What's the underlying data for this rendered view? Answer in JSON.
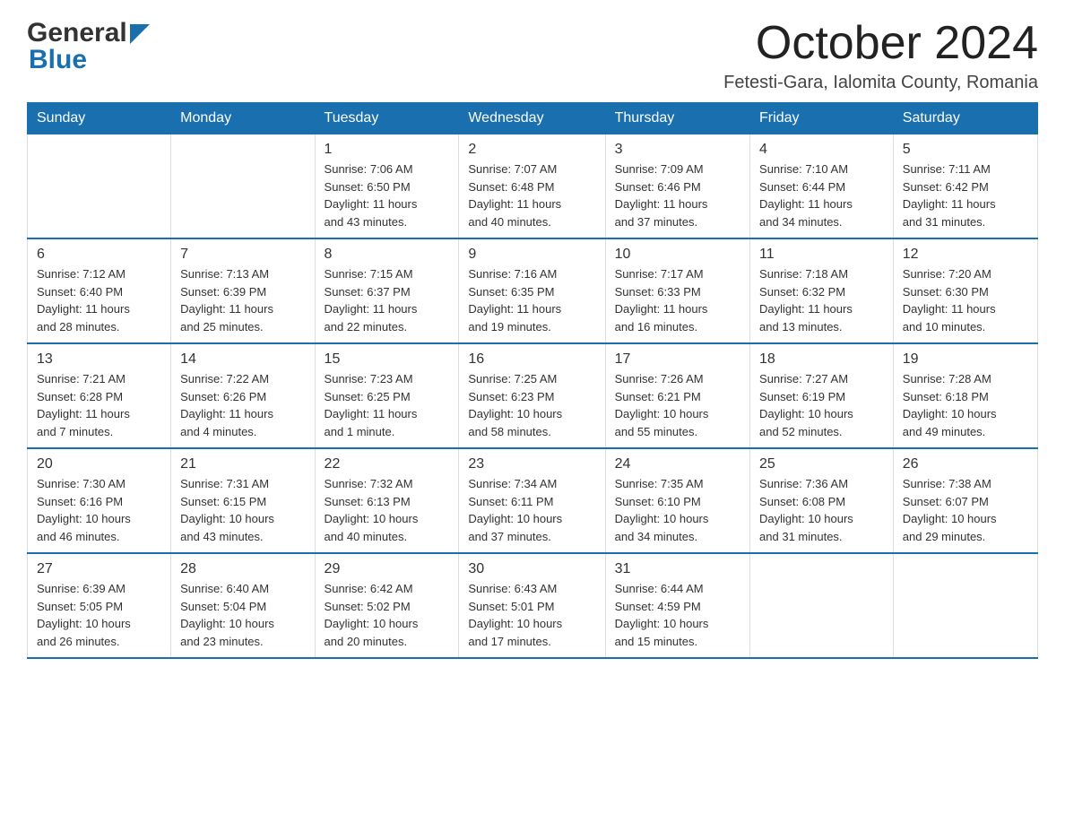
{
  "logo": {
    "general": "General",
    "blue": "Blue"
  },
  "header": {
    "title": "October 2024",
    "subtitle": "Fetesti-Gara, Ialomita County, Romania"
  },
  "days_of_week": [
    "Sunday",
    "Monday",
    "Tuesday",
    "Wednesday",
    "Thursday",
    "Friday",
    "Saturday"
  ],
  "weeks": [
    [
      {
        "day": "",
        "info": ""
      },
      {
        "day": "",
        "info": ""
      },
      {
        "day": "1",
        "info": "Sunrise: 7:06 AM\nSunset: 6:50 PM\nDaylight: 11 hours\nand 43 minutes."
      },
      {
        "day": "2",
        "info": "Sunrise: 7:07 AM\nSunset: 6:48 PM\nDaylight: 11 hours\nand 40 minutes."
      },
      {
        "day": "3",
        "info": "Sunrise: 7:09 AM\nSunset: 6:46 PM\nDaylight: 11 hours\nand 37 minutes."
      },
      {
        "day": "4",
        "info": "Sunrise: 7:10 AM\nSunset: 6:44 PM\nDaylight: 11 hours\nand 34 minutes."
      },
      {
        "day": "5",
        "info": "Sunrise: 7:11 AM\nSunset: 6:42 PM\nDaylight: 11 hours\nand 31 minutes."
      }
    ],
    [
      {
        "day": "6",
        "info": "Sunrise: 7:12 AM\nSunset: 6:40 PM\nDaylight: 11 hours\nand 28 minutes."
      },
      {
        "day": "7",
        "info": "Sunrise: 7:13 AM\nSunset: 6:39 PM\nDaylight: 11 hours\nand 25 minutes."
      },
      {
        "day": "8",
        "info": "Sunrise: 7:15 AM\nSunset: 6:37 PM\nDaylight: 11 hours\nand 22 minutes."
      },
      {
        "day": "9",
        "info": "Sunrise: 7:16 AM\nSunset: 6:35 PM\nDaylight: 11 hours\nand 19 minutes."
      },
      {
        "day": "10",
        "info": "Sunrise: 7:17 AM\nSunset: 6:33 PM\nDaylight: 11 hours\nand 16 minutes."
      },
      {
        "day": "11",
        "info": "Sunrise: 7:18 AM\nSunset: 6:32 PM\nDaylight: 11 hours\nand 13 minutes."
      },
      {
        "day": "12",
        "info": "Sunrise: 7:20 AM\nSunset: 6:30 PM\nDaylight: 11 hours\nand 10 minutes."
      }
    ],
    [
      {
        "day": "13",
        "info": "Sunrise: 7:21 AM\nSunset: 6:28 PM\nDaylight: 11 hours\nand 7 minutes."
      },
      {
        "day": "14",
        "info": "Sunrise: 7:22 AM\nSunset: 6:26 PM\nDaylight: 11 hours\nand 4 minutes."
      },
      {
        "day": "15",
        "info": "Sunrise: 7:23 AM\nSunset: 6:25 PM\nDaylight: 11 hours\nand 1 minute."
      },
      {
        "day": "16",
        "info": "Sunrise: 7:25 AM\nSunset: 6:23 PM\nDaylight: 10 hours\nand 58 minutes."
      },
      {
        "day": "17",
        "info": "Sunrise: 7:26 AM\nSunset: 6:21 PM\nDaylight: 10 hours\nand 55 minutes."
      },
      {
        "day": "18",
        "info": "Sunrise: 7:27 AM\nSunset: 6:19 PM\nDaylight: 10 hours\nand 52 minutes."
      },
      {
        "day": "19",
        "info": "Sunrise: 7:28 AM\nSunset: 6:18 PM\nDaylight: 10 hours\nand 49 minutes."
      }
    ],
    [
      {
        "day": "20",
        "info": "Sunrise: 7:30 AM\nSunset: 6:16 PM\nDaylight: 10 hours\nand 46 minutes."
      },
      {
        "day": "21",
        "info": "Sunrise: 7:31 AM\nSunset: 6:15 PM\nDaylight: 10 hours\nand 43 minutes."
      },
      {
        "day": "22",
        "info": "Sunrise: 7:32 AM\nSunset: 6:13 PM\nDaylight: 10 hours\nand 40 minutes."
      },
      {
        "day": "23",
        "info": "Sunrise: 7:34 AM\nSunset: 6:11 PM\nDaylight: 10 hours\nand 37 minutes."
      },
      {
        "day": "24",
        "info": "Sunrise: 7:35 AM\nSunset: 6:10 PM\nDaylight: 10 hours\nand 34 minutes."
      },
      {
        "day": "25",
        "info": "Sunrise: 7:36 AM\nSunset: 6:08 PM\nDaylight: 10 hours\nand 31 minutes."
      },
      {
        "day": "26",
        "info": "Sunrise: 7:38 AM\nSunset: 6:07 PM\nDaylight: 10 hours\nand 29 minutes."
      }
    ],
    [
      {
        "day": "27",
        "info": "Sunrise: 6:39 AM\nSunset: 5:05 PM\nDaylight: 10 hours\nand 26 minutes."
      },
      {
        "day": "28",
        "info": "Sunrise: 6:40 AM\nSunset: 5:04 PM\nDaylight: 10 hours\nand 23 minutes."
      },
      {
        "day": "29",
        "info": "Sunrise: 6:42 AM\nSunset: 5:02 PM\nDaylight: 10 hours\nand 20 minutes."
      },
      {
        "day": "30",
        "info": "Sunrise: 6:43 AM\nSunset: 5:01 PM\nDaylight: 10 hours\nand 17 minutes."
      },
      {
        "day": "31",
        "info": "Sunrise: 6:44 AM\nSunset: 4:59 PM\nDaylight: 10 hours\nand 15 minutes."
      },
      {
        "day": "",
        "info": ""
      },
      {
        "day": "",
        "info": ""
      }
    ]
  ]
}
